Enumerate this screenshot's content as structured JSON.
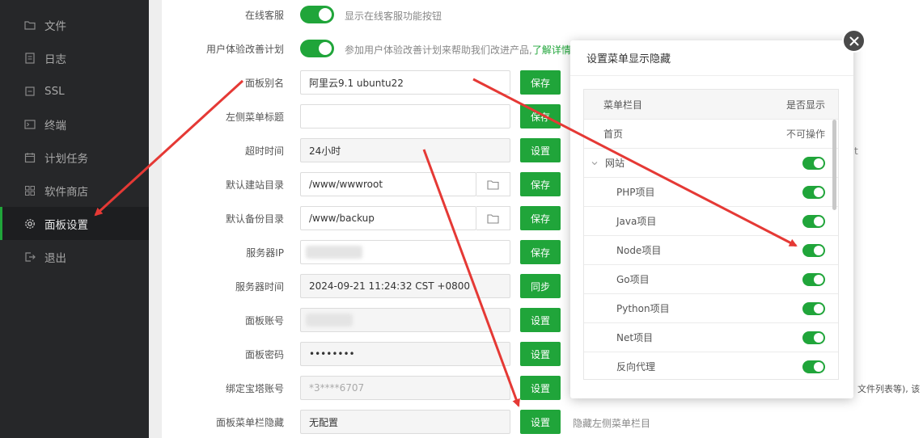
{
  "sidebar": {
    "items": [
      {
        "label": "文件",
        "icon": "folder-icon"
      },
      {
        "label": "日志",
        "icon": "log-icon"
      },
      {
        "label": "SSL",
        "icon": "ssl-icon"
      },
      {
        "label": "终端",
        "icon": "terminal-icon"
      },
      {
        "label": "计划任务",
        "icon": "calendar-icon"
      },
      {
        "label": "软件商店",
        "icon": "grid-icon"
      },
      {
        "label": "面板设置",
        "icon": "gear-icon",
        "active": true
      },
      {
        "label": "退出",
        "icon": "logout-icon"
      }
    ]
  },
  "settings": {
    "online_service": {
      "label": "在线客服",
      "hint": "显示在线客服功能按钮"
    },
    "ux_plan": {
      "label": "用户体验改善计划",
      "hint": "参加用户体验改善计划来帮助我们改进产品,",
      "link": "了解详情"
    },
    "panel_alias": {
      "label": "面板别名",
      "value": "阿里云9.1 ubuntu22",
      "button": "保存"
    },
    "left_menu_title": {
      "label": "左侧菜单标题",
      "value": "",
      "button": "保存"
    },
    "timeout": {
      "label": "超时时间",
      "value": "24小时",
      "button": "设置"
    },
    "default_site_dir": {
      "label": "默认建站目录",
      "value": "/www/wwwroot",
      "button": "保存"
    },
    "default_backup_dir": {
      "label": "默认备份目录",
      "value": "/www/backup",
      "button": "保存"
    },
    "server_ip": {
      "label": "服务器IP",
      "value": "",
      "button": "保存"
    },
    "server_time": {
      "label": "服务器时间",
      "value": "2024-09-21 11:24:32 CST +0800",
      "button": "同步"
    },
    "panel_account": {
      "label": "面板账号",
      "value": "",
      "button": "设置"
    },
    "panel_password": {
      "label": "面板密码",
      "value": "••••••••",
      "button": "设置"
    },
    "bind_bt_account": {
      "label": "绑定宝塔账号",
      "value": "*3****6707",
      "button": "设置"
    },
    "menu_hide": {
      "label": "面板菜单栏隐藏",
      "value": "无配置",
      "button": "设置",
      "hint": "隐藏左侧菜单栏目"
    }
  },
  "peek_text": {
    "right_1": "t",
    "right_2": "文件列表等), 该"
  },
  "modal": {
    "title": "设置菜单显示隐藏",
    "col_menu": "菜单栏目",
    "col_show": "是否显示",
    "rows": [
      {
        "name": "首页",
        "status": "不可操作"
      },
      {
        "name": "网站",
        "expandable": true,
        "on": true
      },
      {
        "name": "PHP项目",
        "on": true
      },
      {
        "name": "Java项目",
        "on": true
      },
      {
        "name": "Node项目",
        "on": true
      },
      {
        "name": "Go项目",
        "on": true
      },
      {
        "name": "Python项目",
        "on": true
      },
      {
        "name": "Net项目",
        "on": true
      },
      {
        "name": "反向代理",
        "on": true
      }
    ]
  },
  "colors": {
    "accent": "#20a53a",
    "sidebar_bg": "#262729",
    "arrow": "#e53935"
  }
}
